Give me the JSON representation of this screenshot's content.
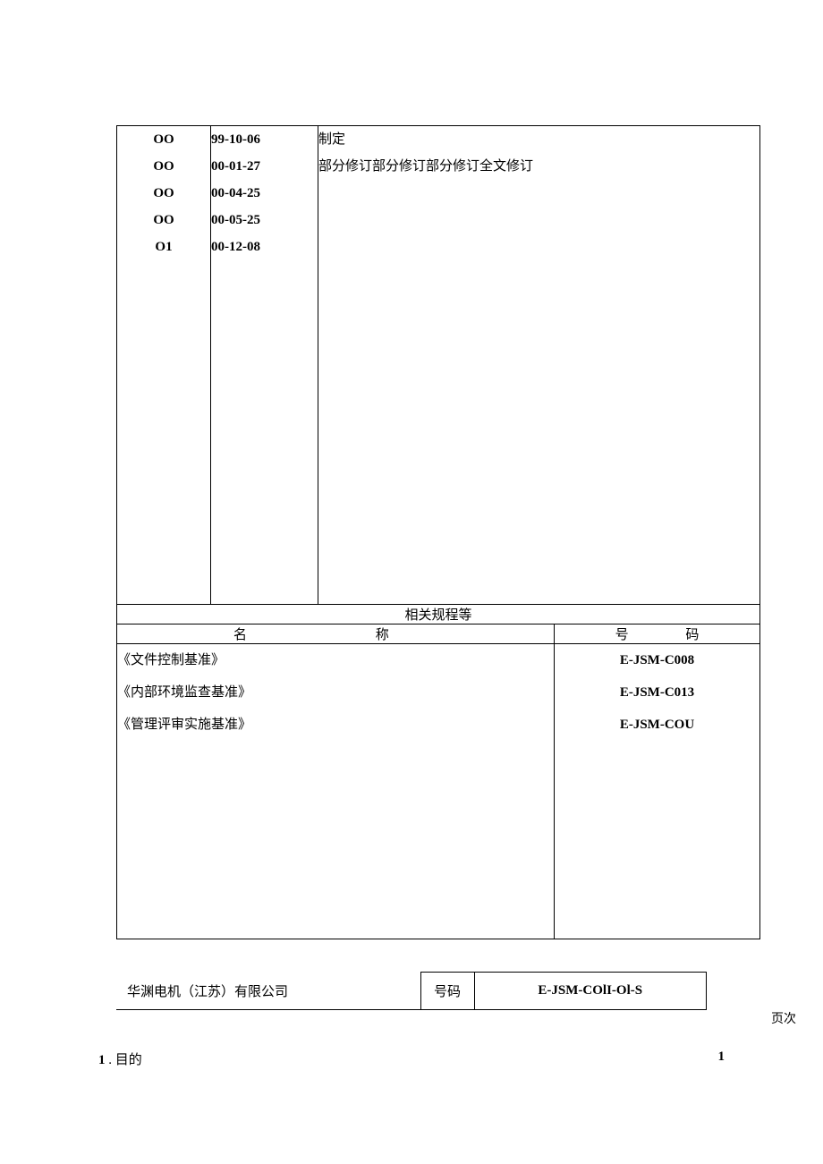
{
  "revisions": {
    "codes": [
      "OO",
      "OO",
      "OO",
      "OO",
      "O1"
    ],
    "dates": [
      "99-10-06",
      "00-01-27",
      "00-04-25",
      "00-05-25",
      "00-12-08"
    ],
    "desc_line1": "制定",
    "desc_line2": "部分修订部分修订部分修订全文修订"
  },
  "section_header": "相关规程等",
  "name_header": {
    "char1": "名",
    "char2": "称"
  },
  "code_header": {
    "char1": "号",
    "char2": "码"
  },
  "related": {
    "names": [
      "《文件控制基准》",
      "《内部环境监查基准》",
      "《管理评审实施基准》"
    ],
    "codes": [
      "E-JSM-C008",
      "E-JSM-C013",
      "E-JSM-COU"
    ]
  },
  "footer": {
    "company": "华渊电机（江苏）有限公司",
    "label": "号码",
    "code": "E-JSM-COlI-Ol-S",
    "page_label": "页次"
  },
  "bottom": {
    "num": "1",
    "dot": " . ",
    "text": "目的",
    "pageno": "1"
  }
}
